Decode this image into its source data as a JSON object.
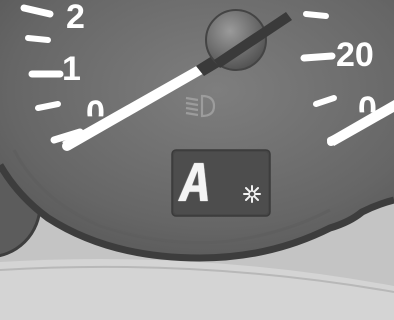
{
  "speedometer": {
    "scale_labels": [
      "2",
      "1",
      "0"
    ]
  },
  "tachometer": {
    "scale_labels": [
      "20",
      "0"
    ]
  },
  "display": {
    "mode_character": "A",
    "snowflake_symbol": "❄"
  },
  "indicators": {
    "headlamp_icon": "low-beam-headlight-icon"
  },
  "colors": {
    "dial_face": "#6e6e6e",
    "display_background": "#4a4a4a",
    "needle": "#ffffff"
  }
}
